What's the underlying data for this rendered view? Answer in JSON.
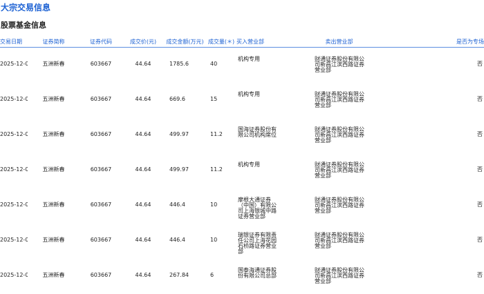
{
  "page": {
    "title": "大宗交易信息",
    "section_title": "股票基金信息"
  },
  "table": {
    "headers": {
      "date": "交易日期",
      "name": "证券简称",
      "code": "证券代码",
      "price": "成交价(元)",
      "amount": "成交金额(万元)",
      "volume": "成交量(＊)",
      "buyer": "买入营业部",
      "seller": "卖出营业部",
      "flag": "是否为专场"
    },
    "rows": [
      {
        "date": "2025-12-08",
        "name": "五洲新春",
        "code": "603667",
        "price": "44.64",
        "amount": "1785.6",
        "volume": "40",
        "buyer": "机构专用",
        "seller": "财通证券股份有限公司新昌江滨西路证券营业部",
        "flag": "否"
      },
      {
        "date": "2025-12-08",
        "name": "五洲新春",
        "code": "603667",
        "price": "44.64",
        "amount": "669.6",
        "volume": "15",
        "buyer": "机构专用",
        "seller": "财通证券股份有限公司新昌江滨西路证券营业部",
        "flag": "否"
      },
      {
        "date": "2025-12-08",
        "name": "五洲新春",
        "code": "603667",
        "price": "44.64",
        "amount": "499.97",
        "volume": "11.2",
        "buyer": "国海证券股份有限公司机构席位",
        "seller": "财通证券股份有限公司新昌江滨西路证券营业部",
        "flag": "否"
      },
      {
        "date": "2025-12-08",
        "name": "五洲新春",
        "code": "603667",
        "price": "44.64",
        "amount": "499.97",
        "volume": "11.2",
        "buyer": "机构专用",
        "seller": "财通证券股份有限公司新昌江滨西路证券营业部",
        "flag": "否"
      },
      {
        "date": "2025-12-08",
        "name": "五洲新春",
        "code": "603667",
        "price": "44.64",
        "amount": "446.4",
        "volume": "10",
        "buyer": "摩根大通证券（中国）有限公司上海银城中路证券营业部",
        "seller": "财通证券股份有限公司新昌江滨西路证券营业部",
        "flag": "否"
      },
      {
        "date": "2025-12-08",
        "name": "五洲新春",
        "code": "603667",
        "price": "44.64",
        "amount": "446.4",
        "volume": "10",
        "buyer": "瑞银证券有限责任公司上海花园石桥路证券营业部",
        "seller": "财通证券股份有限公司新昌江滨西路证券营业部",
        "flag": "否"
      },
      {
        "date": "2025-12-08",
        "name": "五洲新春",
        "code": "603667",
        "price": "44.64",
        "amount": "267.84",
        "volume": "6",
        "buyer": "国泰海通证券股份有限公司总部",
        "seller": "财通证券股份有限公司新昌江滨西路证券营业部",
        "flag": "否"
      }
    ]
  }
}
